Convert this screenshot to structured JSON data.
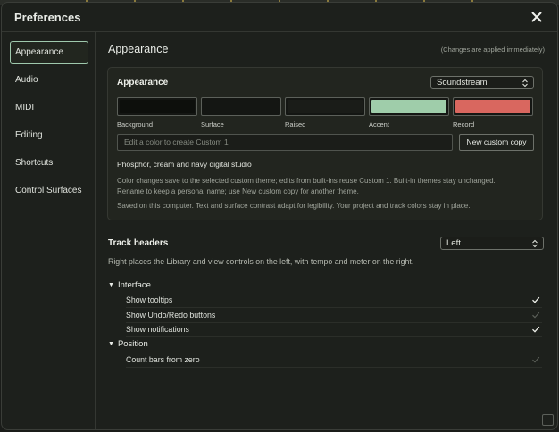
{
  "dialog": {
    "title": "Preferences"
  },
  "sidebar": {
    "items": [
      {
        "label": "Appearance"
      },
      {
        "label": "Audio"
      },
      {
        "label": "MIDI"
      },
      {
        "label": "Editing"
      },
      {
        "label": "Shortcuts"
      },
      {
        "label": "Control Surfaces"
      }
    ],
    "active": "Appearance"
  },
  "appearance": {
    "section_title": "Appearance",
    "note": "(Changes are applied immediately)",
    "card_title": "Appearance",
    "theme_select": "Soundstream",
    "swatches": [
      {
        "label": "Background",
        "color": "#0d0f0c"
      },
      {
        "label": "Surface",
        "color": "#141613"
      },
      {
        "label": "Raised",
        "color": "#1a1c18"
      },
      {
        "label": "Accent",
        "color": "#9fcdaa"
      },
      {
        "label": "Record",
        "color": "#d9675f"
      }
    ],
    "custom_placeholder": "Edit a color to create Custom 1",
    "custom_button": "New custom copy",
    "theme_name": "Phosphor, cream and navy digital studio",
    "help1a": "Color changes save to the selected custom theme; edits from built-ins reuse Custom 1. Built-in themes stay unchanged.",
    "help1b": "Rename to keep a personal name; use New custom copy for another theme.",
    "help2": "Saved on this computer. Text and surface contrast adapt for legibility. Your project and track colors stay in place."
  },
  "track_headers": {
    "label": "Track headers",
    "select": "Left",
    "description": "Right places the Library and view controls on the left, with tempo and meter on the right."
  },
  "groups": {
    "interface": {
      "label": "Interface",
      "items": [
        {
          "label": "Show tooltips",
          "checked": true
        },
        {
          "label": "Show Undo/Redo buttons",
          "checked": false
        },
        {
          "label": "Show notifications",
          "checked": true
        }
      ]
    },
    "position": {
      "label": "Position",
      "items": [
        {
          "label": "Count bars from zero",
          "checked": false
        }
      ]
    }
  },
  "colors": {
    "accent": "#9fc9ad",
    "record": "#d9675f"
  }
}
